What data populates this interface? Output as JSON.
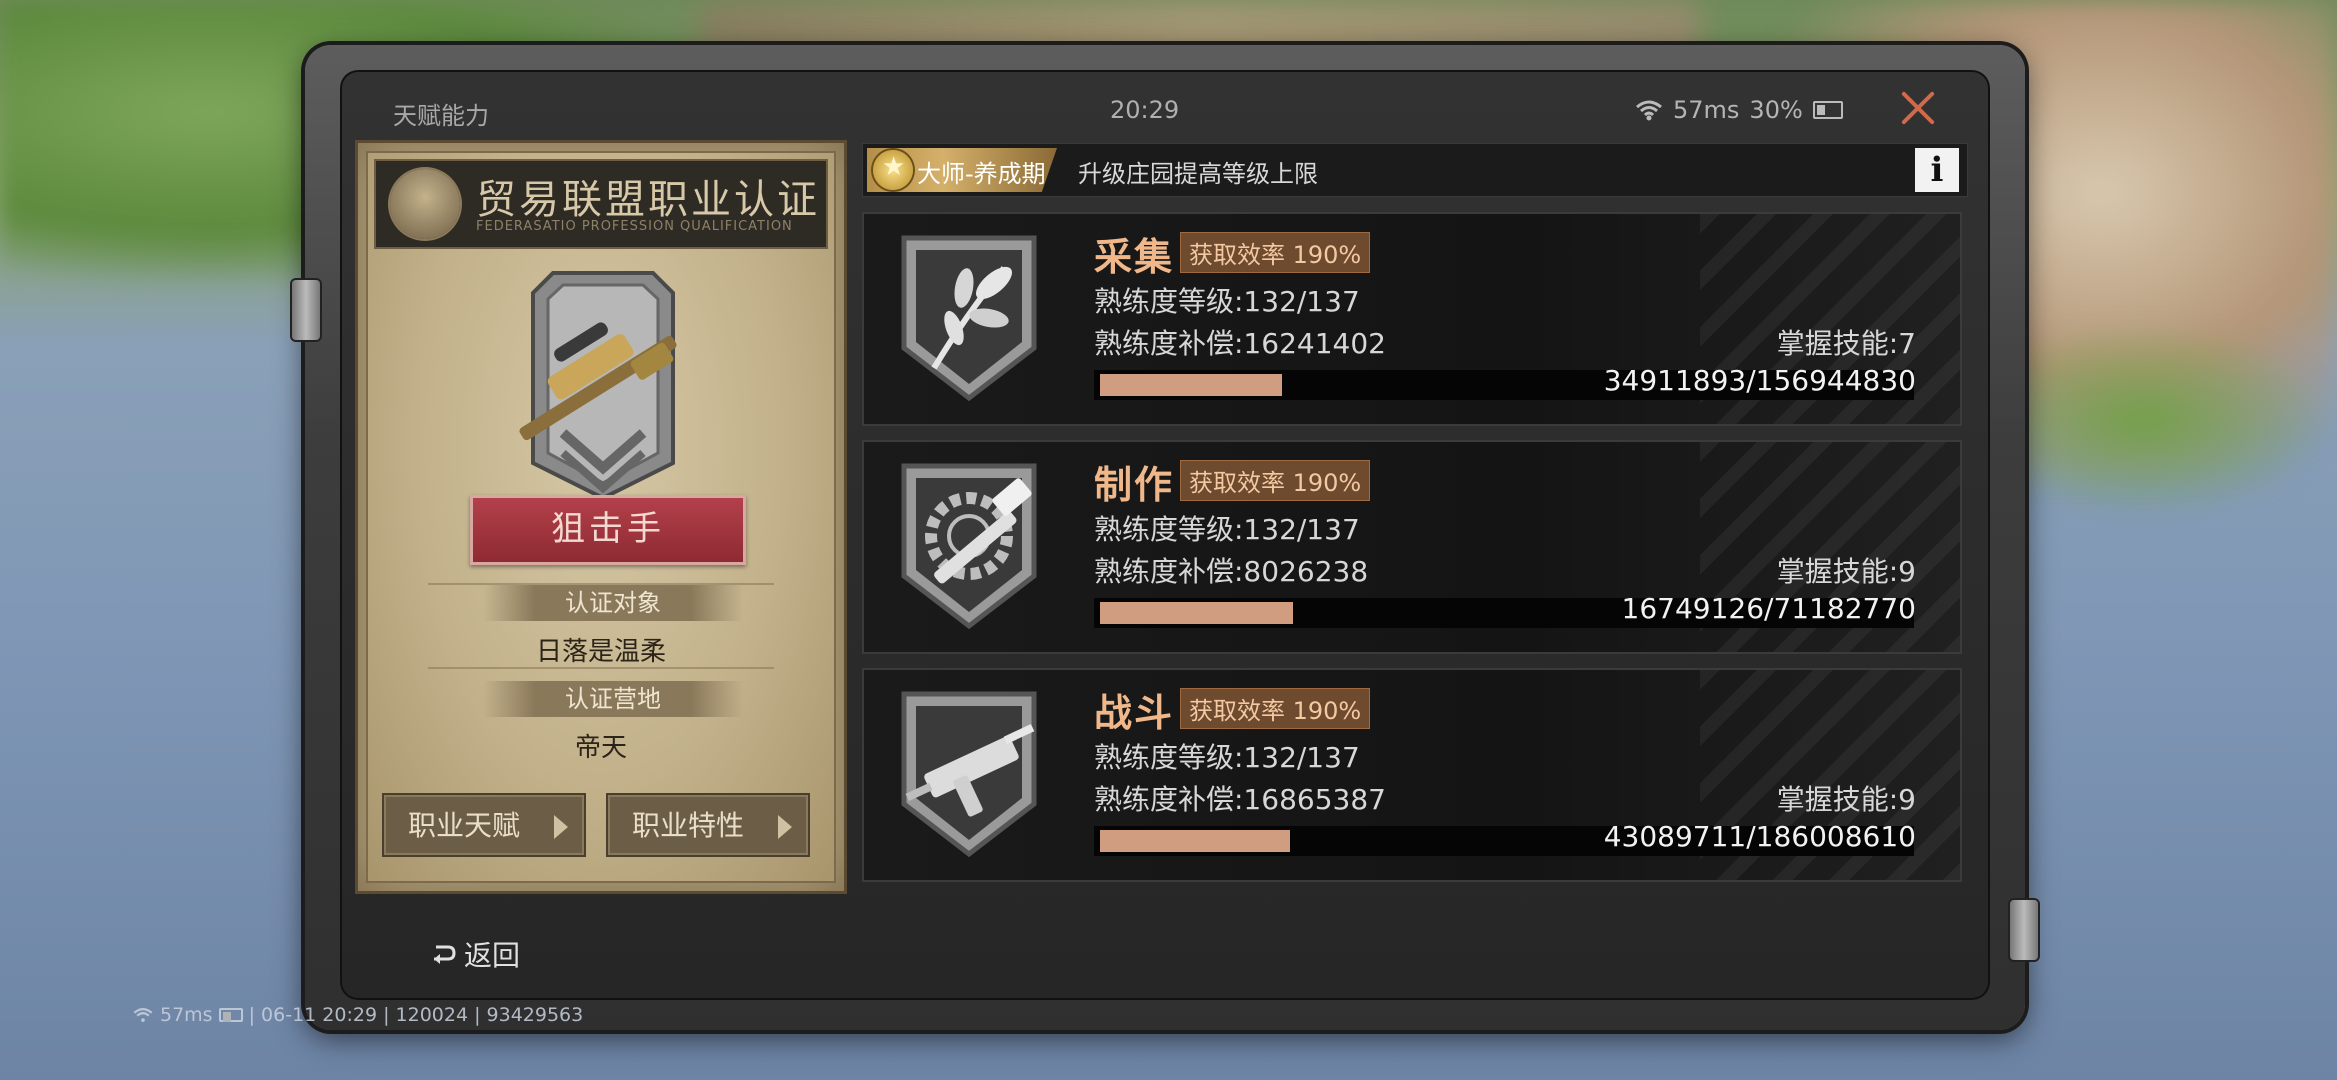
{
  "window": {
    "title": "天赋能力",
    "time": "20:29",
    "ping": "57ms",
    "battery": "30%"
  },
  "certificate": {
    "title": "贸易联盟职业认证",
    "subtitle": "FEDERASATIO PROFESSION QUALIFICATION",
    "class_name": "狙击手",
    "target_label": "认证对象",
    "target_value": "日落是温柔",
    "camp_label": "认证营地",
    "camp_value": "帝天",
    "btn_talent": "职业天赋",
    "btn_trait": "职业特性"
  },
  "rank": {
    "badge": "大师-养成期",
    "description": "升级庄园提高等级上限",
    "info": "i"
  },
  "skills": [
    {
      "name": "采集",
      "efficiency": "获取效率 190%",
      "level": "熟练度等级:132/137",
      "bonus": "熟练度补偿:16241402",
      "mastered": "掌握技能:7",
      "exp": "34911893/156944830",
      "progress": 0.222
    },
    {
      "name": "制作",
      "efficiency": "获取效率 190%",
      "level": "熟练度等级:132/137",
      "bonus": "熟练度补偿:8026238",
      "mastered": "掌握技能:9",
      "exp": "16749126/71182770",
      "progress": 0.235
    },
    {
      "name": "战斗",
      "efficiency": "获取效率 190%",
      "level": "熟练度等级:132/137",
      "bonus": "熟练度补偿:16865387",
      "mastered": "掌握技能:9",
      "exp": "43089711/186008610",
      "progress": 0.232
    }
  ],
  "footer": {
    "back": "返回",
    "ping": "57ms",
    "info": "| 06-11 20:29 | 120024 | 93429563"
  },
  "colors": {
    "accent": "#f0b88a",
    "progress": "#d09d80",
    "close": "#d06a4a",
    "class_badge": "#b3404a"
  }
}
